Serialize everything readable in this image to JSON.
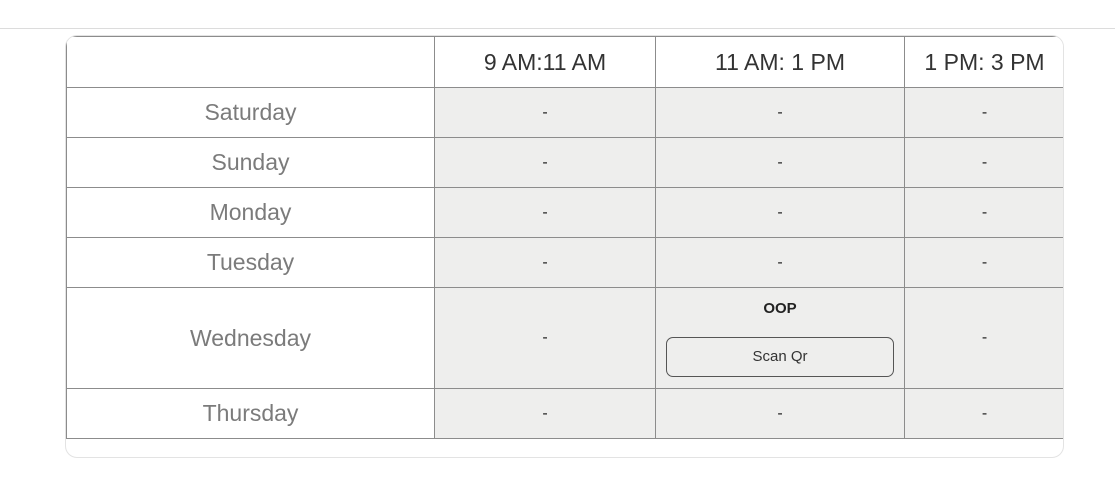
{
  "table": {
    "corner_label": "",
    "time_slots": [
      "9 AM:11 AM",
      "11 AM: 1 PM",
      "1 PM: 3 PM"
    ],
    "rows": [
      {
        "day": "Saturday",
        "slots": [
          "-",
          "-",
          "-"
        ]
      },
      {
        "day": "Sunday",
        "slots": [
          "-",
          "-",
          "-"
        ]
      },
      {
        "day": "Monday",
        "slots": [
          "-",
          "-",
          "-"
        ]
      },
      {
        "day": "Tuesday",
        "slots": [
          "-",
          "-",
          "-"
        ]
      },
      {
        "day": "Wednesday",
        "slots": [
          "-",
          {
            "course": "OOP",
            "button": "Scan Qr"
          },
          "-"
        ]
      },
      {
        "day": "Thursday",
        "slots": [
          "-",
          "-",
          "-"
        ]
      }
    ]
  },
  "colors": {
    "slot_background": "#eeeeed",
    "border": "#8c8c8c",
    "day_text": "#7b7b7b"
  }
}
